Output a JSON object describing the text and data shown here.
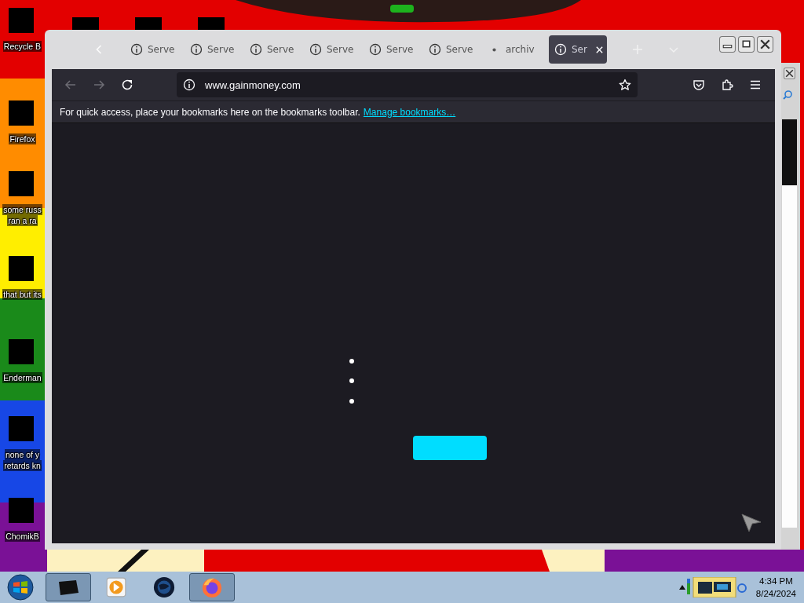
{
  "desktop_icons": [
    {
      "lines": [
        "Recycle B"
      ]
    },
    {
      "lines": [
        "Firefox"
      ]
    },
    {
      "lines": [
        "some russ",
        "ran a ra"
      ]
    },
    {
      "lines": [
        "that but its"
      ]
    },
    {
      "lines": [
        "Enderman"
      ]
    },
    {
      "lines": [
        "none of y",
        "retards kn"
      ]
    },
    {
      "lines": [
        "ChomikB"
      ]
    }
  ],
  "browser": {
    "tabs": [
      {
        "label": "Serve",
        "kind": "info",
        "selected": false
      },
      {
        "label": "Serve",
        "kind": "info",
        "selected": false
      },
      {
        "label": "Serve",
        "kind": "info",
        "selected": false
      },
      {
        "label": "Serve",
        "kind": "info",
        "selected": false
      },
      {
        "label": "Serve",
        "kind": "info",
        "selected": false
      },
      {
        "label": "Serve",
        "kind": "info",
        "selected": false
      },
      {
        "label": "archiv",
        "kind": "dot",
        "selected": false
      },
      {
        "label": "Ser",
        "kind": "info",
        "selected": true
      }
    ],
    "back": {
      "disabled": true
    },
    "forward": {
      "disabled": true
    },
    "url": "www.gainmoney.com",
    "bookmarks_bar": {
      "text": "For quick access, place your bookmarks here on the bookmarks toolbar.",
      "link": "Manage bookmarks…"
    }
  },
  "taskbar": {
    "items": [
      {
        "kind": "window",
        "selected": true
      },
      {
        "kind": "media",
        "selected": false
      },
      {
        "kind": "globe",
        "selected": false
      },
      {
        "kind": "firefox",
        "selected": true
      }
    ],
    "time": "4:34 PM",
    "date": "8/24/2024"
  }
}
